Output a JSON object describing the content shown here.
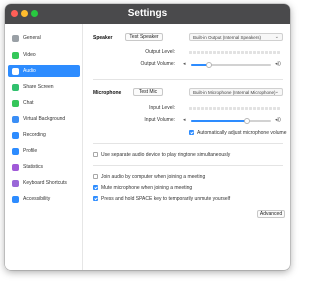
{
  "window": {
    "title": "Settings"
  },
  "sidebar": {
    "items": [
      {
        "label": "General",
        "icon": "general-icon",
        "color": "#9aa0a6"
      },
      {
        "label": "Video",
        "icon": "video-icon",
        "color": "#34c759"
      },
      {
        "label": "Audio",
        "icon": "audio-icon",
        "color": "#ffffff",
        "active": true
      },
      {
        "label": "Share Screen",
        "icon": "share-screen-icon",
        "color": "#30c06e"
      },
      {
        "label": "Chat",
        "icon": "chat-icon",
        "color": "#35c659"
      },
      {
        "label": "Virtual Background",
        "icon": "virtual-background-icon",
        "color": "#3a8ef6"
      },
      {
        "label": "Recording",
        "icon": "recording-icon",
        "color": "#2d8cff"
      },
      {
        "label": "Profile",
        "icon": "profile-icon",
        "color": "#2d8cff"
      },
      {
        "label": "Statistics",
        "icon": "statistics-icon",
        "color": "#a05ad8"
      },
      {
        "label": "Keyboard Shortcuts",
        "icon": "keyboard-icon",
        "color": "#9a67d8"
      },
      {
        "label": "Accessibility",
        "icon": "accessibility-icon",
        "color": "#2d8cff"
      }
    ]
  },
  "speaker": {
    "section_label": "Speaker",
    "test_button": "Test Speaker",
    "device": "Built-in Output (Internal Speakers)",
    "output_level_label": "Output Level:",
    "output_volume_label": "Output Volume:",
    "volume": 0.22
  },
  "microphone": {
    "section_label": "Microphone",
    "test_button": "Test Mic",
    "device": "Built-in Microphone (Internal Microphone)",
    "input_level_label": "Input Level:",
    "input_volume_label": "Input Volume:",
    "volume": 0.7,
    "auto_adjust_label": "Automatically adjust microphone volume",
    "auto_adjust_checked": true
  },
  "ringtone": {
    "label": "Use separate audio device to play ringtone simultaneously",
    "checked": false
  },
  "options": [
    {
      "label": "Join audio by computer when joining a meeting",
      "checked": false
    },
    {
      "label": "Mute microphone when joining a meeting",
      "checked": true
    },
    {
      "label": "Press and hold SPACE key to temporarily unmute yourself",
      "checked": true
    }
  ],
  "advanced_button": "Advanced"
}
